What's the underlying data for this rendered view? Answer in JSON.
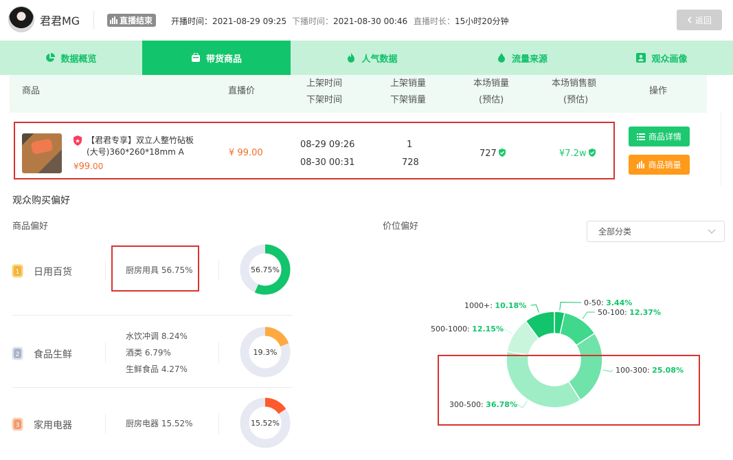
{
  "header": {
    "username": "君君MG",
    "live_status": "直播结束",
    "start_label": "开播时间：",
    "start_value": "2021-08-29 09:25",
    "end_label": "下播时间：",
    "end_value": "2021-08-30 00:46",
    "duration_label": "直播时长：",
    "duration_value": "15小时20分钟",
    "back_label": "返回"
  },
  "tabs": [
    {
      "label": "数据概览",
      "icon": "pie-chart-icon",
      "active": false
    },
    {
      "label": "带货商品",
      "icon": "shopping-bag-icon",
      "active": true
    },
    {
      "label": "人气数据",
      "icon": "flame-icon",
      "active": false
    },
    {
      "label": "流量来源",
      "icon": "drop-icon",
      "active": false
    },
    {
      "label": "观众画像",
      "icon": "portrait-icon",
      "active": false
    }
  ],
  "table": {
    "headers": {
      "product": "商品",
      "live_price": "直播价",
      "list_time": "上架时间",
      "delist_time": "下架时间",
      "list_sales": "上架销量",
      "delist_sales": "下架销量",
      "session_sales": "本场销量",
      "session_sales_est": "(预估)",
      "session_amount": "本场销售额",
      "session_amount_est": "(预估)",
      "actions": "操作"
    },
    "row": {
      "name_line1": "【君君专享】双立人整竹砧板",
      "name_line2": "(大号)360*260*18mm A",
      "price_symbol": "¥",
      "price_int": "99",
      "price_dec": ".00",
      "live_price": "¥ 99.00",
      "list_time": "08-29 09:26",
      "delist_time": "08-30 00:31",
      "list_sales": "1",
      "delist_sales": "728",
      "session_sales": "727",
      "session_amount": "¥7.2w",
      "detail_button": "商品详情",
      "sales_button": "商品销量"
    }
  },
  "preferences": {
    "title": "观众购买偏好",
    "product_pref_title": "商品偏好",
    "price_pref_title": "价位偏好",
    "dropdown_value": "全部分类",
    "categories": [
      {
        "rank": "1",
        "name": "日用百货",
        "subs": [
          "厨房用具 56.75%"
        ],
        "percent": 56.75,
        "percent_label": "56.75%",
        "color": "#12c46b"
      },
      {
        "rank": "2",
        "name": "食品生鲜",
        "subs": [
          "水饮冲调 8.24%",
          "酒类 6.79%",
          "生鲜食品 4.27%"
        ],
        "percent": 19.3,
        "percent_label": "19.3%",
        "color": "#ffa940"
      },
      {
        "rank": "3",
        "name": "家用电器",
        "subs": [
          "厨房电器 15.52%"
        ],
        "percent": 15.52,
        "percent_label": "15.52%",
        "color": "#ff5a2c"
      }
    ],
    "price_segments": [
      {
        "label": "0-50:",
        "value": "3.44%",
        "percent": 3.44,
        "color": "#12c46b"
      },
      {
        "label": "50-100:",
        "value": "12.37%",
        "percent": 12.37,
        "color": "#3fd88c"
      },
      {
        "label": "100-300:",
        "value": "25.08%",
        "percent": 25.08,
        "color": "#6fe3a9"
      },
      {
        "label": "300-500:",
        "value": "36.78%",
        "percent": 36.78,
        "color": "#9eedc5"
      },
      {
        "label": "500-1000:",
        "value": "12.15%",
        "percent": 12.15,
        "color": "#c9f5dd"
      },
      {
        "label": "1000+:",
        "value": "10.18%",
        "percent": 10.18,
        "color": "#12c46b"
      }
    ]
  }
}
